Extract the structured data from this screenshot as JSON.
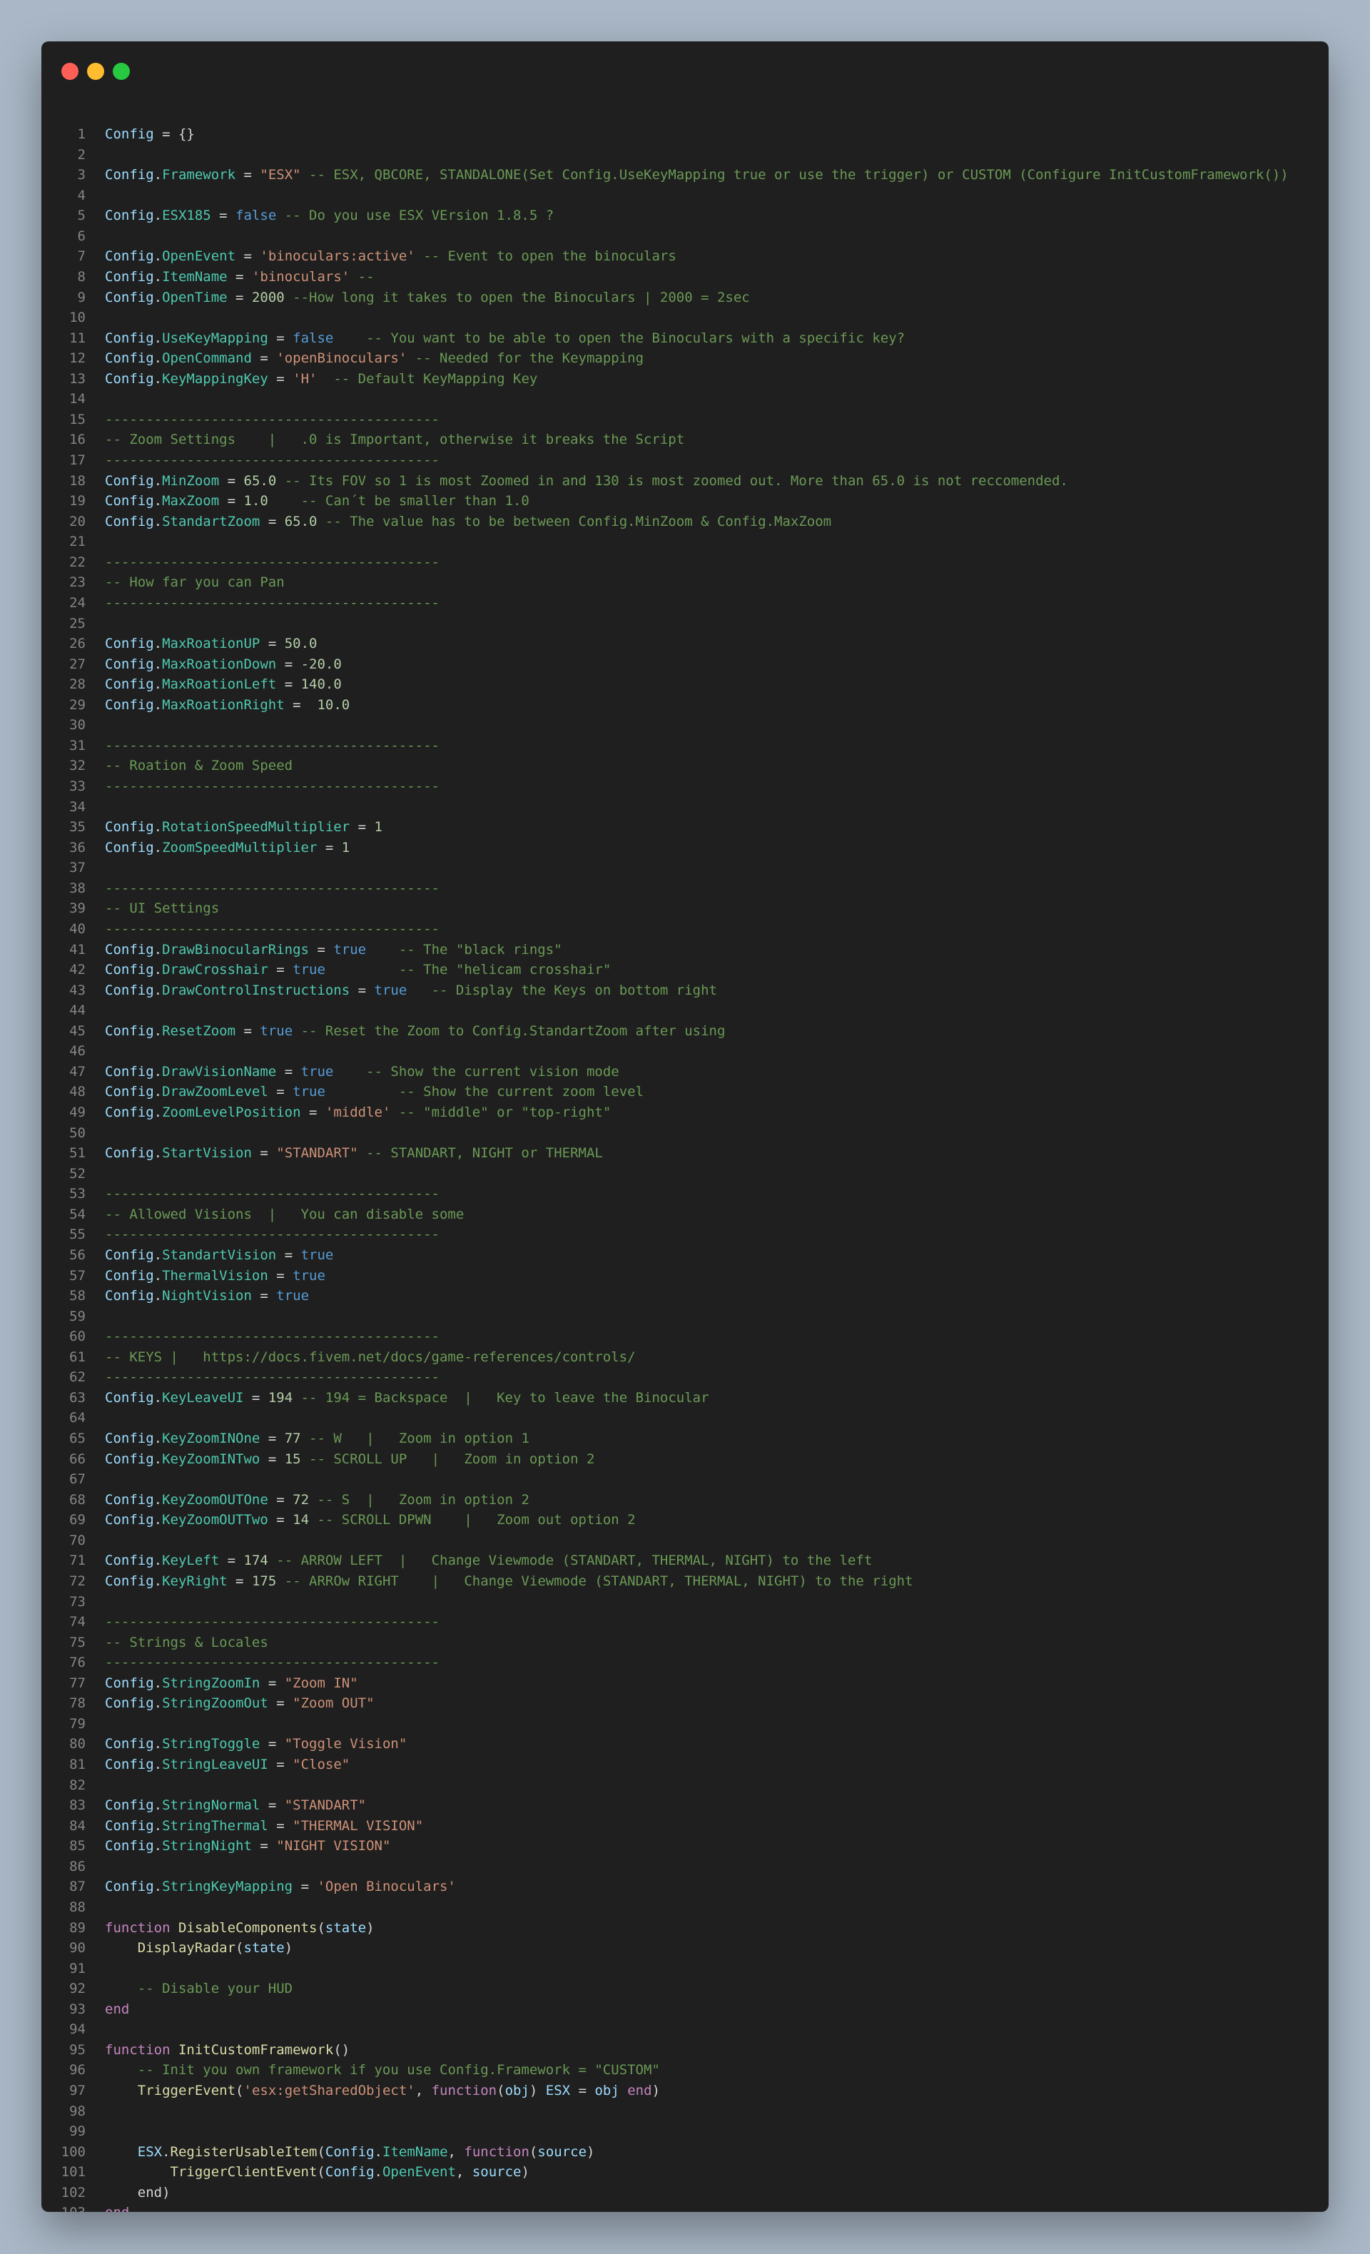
{
  "colors": {
    "background": "#a9b7c6",
    "editor": "#1f1f1f",
    "close": "#ff5f57",
    "minimize": "#febc2e",
    "zoom": "#28c840"
  },
  "lines": [
    [
      [
        "var",
        "Config"
      ],
      [
        "pl",
        " = {}"
      ]
    ],
    [],
    [
      [
        "var",
        "Config"
      ],
      [
        "pl",
        "."
      ],
      [
        "prop",
        "Framework"
      ],
      [
        "pl",
        " = "
      ],
      [
        "str",
        "\"ESX\""
      ],
      [
        "com",
        " -- ESX, QBCORE, STANDALONE(Set Config.UseKeyMapping true or use the trigger) or CUSTOM (Configure InitCustomFramework())"
      ]
    ],
    [],
    [
      [
        "var",
        "Config"
      ],
      [
        "pl",
        "."
      ],
      [
        "prop",
        "ESX185"
      ],
      [
        "pl",
        " = "
      ],
      [
        "bool",
        "false"
      ],
      [
        "com",
        " -- Do you use ESX VErsion 1.8.5 ?"
      ]
    ],
    [],
    [
      [
        "var",
        "Config"
      ],
      [
        "pl",
        "."
      ],
      [
        "prop",
        "OpenEvent"
      ],
      [
        "pl",
        " = "
      ],
      [
        "str",
        "'binoculars:active'"
      ],
      [
        "com",
        " -- Event to open the binoculars"
      ]
    ],
    [
      [
        "var",
        "Config"
      ],
      [
        "pl",
        "."
      ],
      [
        "prop",
        "ItemName"
      ],
      [
        "pl",
        " = "
      ],
      [
        "str",
        "'binoculars'"
      ],
      [
        "com",
        " --"
      ]
    ],
    [
      [
        "var",
        "Config"
      ],
      [
        "pl",
        "."
      ],
      [
        "prop",
        "OpenTime"
      ],
      [
        "pl",
        " = "
      ],
      [
        "num",
        "2000"
      ],
      [
        "com",
        " --How long it takes to open the Binoculars | 2000 = 2sec"
      ]
    ],
    [],
    [
      [
        "var",
        "Config"
      ],
      [
        "pl",
        "."
      ],
      [
        "prop",
        "UseKeyMapping"
      ],
      [
        "pl",
        " = "
      ],
      [
        "bool",
        "false"
      ],
      [
        "com",
        "    -- You want to be able to open the Binoculars with a specific key?"
      ]
    ],
    [
      [
        "var",
        "Config"
      ],
      [
        "pl",
        "."
      ],
      [
        "prop",
        "OpenCommand"
      ],
      [
        "pl",
        " = "
      ],
      [
        "str",
        "'openBinoculars'"
      ],
      [
        "com",
        " -- Needed for the Keymapping"
      ]
    ],
    [
      [
        "var",
        "Config"
      ],
      [
        "pl",
        "."
      ],
      [
        "prop",
        "KeyMappingKey"
      ],
      [
        "pl",
        " = "
      ],
      [
        "str",
        "'H'"
      ],
      [
        "com",
        "  -- Default KeyMapping Key"
      ]
    ],
    [],
    [
      [
        "com",
        "-----------------------------------------"
      ]
    ],
    [
      [
        "com",
        "-- Zoom Settings    |   .0 is Important, otherwise it breaks the Script"
      ]
    ],
    [
      [
        "com",
        "-----------------------------------------"
      ]
    ],
    [
      [
        "var",
        "Config"
      ],
      [
        "pl",
        "."
      ],
      [
        "prop",
        "MinZoom"
      ],
      [
        "pl",
        " = "
      ],
      [
        "num",
        "65.0"
      ],
      [
        "com",
        " -- Its FOV so 1 is most Zoomed in and 130 is most zoomed out. More than 65.0 is not reccomended."
      ]
    ],
    [
      [
        "var",
        "Config"
      ],
      [
        "pl",
        "."
      ],
      [
        "prop",
        "MaxZoom"
      ],
      [
        "pl",
        " = "
      ],
      [
        "num",
        "1.0"
      ],
      [
        "com",
        "    -- Can´t be smaller than 1.0"
      ]
    ],
    [
      [
        "var",
        "Config"
      ],
      [
        "pl",
        "."
      ],
      [
        "prop",
        "StandartZoom"
      ],
      [
        "pl",
        " = "
      ],
      [
        "num",
        "65.0"
      ],
      [
        "com",
        " -- The value has to be between Config.MinZoom & Config.MaxZoom"
      ]
    ],
    [],
    [
      [
        "com",
        "-----------------------------------------"
      ]
    ],
    [
      [
        "com",
        "-- How far you can Pan"
      ]
    ],
    [
      [
        "com",
        "-----------------------------------------"
      ]
    ],
    [],
    [
      [
        "var",
        "Config"
      ],
      [
        "pl",
        "."
      ],
      [
        "prop",
        "MaxRoationUP"
      ],
      [
        "pl",
        " = "
      ],
      [
        "num",
        "50.0"
      ]
    ],
    [
      [
        "var",
        "Config"
      ],
      [
        "pl",
        "."
      ],
      [
        "prop",
        "MaxRoationDown"
      ],
      [
        "pl",
        " = "
      ],
      [
        "num",
        "-20.0"
      ]
    ],
    [
      [
        "var",
        "Config"
      ],
      [
        "pl",
        "."
      ],
      [
        "prop",
        "MaxRoationLeft"
      ],
      [
        "pl",
        " = "
      ],
      [
        "num",
        "140.0"
      ]
    ],
    [
      [
        "var",
        "Config"
      ],
      [
        "pl",
        "."
      ],
      [
        "prop",
        "MaxRoationRight"
      ],
      [
        "pl",
        " =  "
      ],
      [
        "num",
        "10.0"
      ]
    ],
    [],
    [
      [
        "com",
        "-----------------------------------------"
      ]
    ],
    [
      [
        "com",
        "-- Roation & Zoom Speed"
      ]
    ],
    [
      [
        "com",
        "-----------------------------------------"
      ]
    ],
    [],
    [
      [
        "var",
        "Config"
      ],
      [
        "pl",
        "."
      ],
      [
        "prop",
        "RotationSpeedMultiplier"
      ],
      [
        "pl",
        " = "
      ],
      [
        "num",
        "1"
      ]
    ],
    [
      [
        "var",
        "Config"
      ],
      [
        "pl",
        "."
      ],
      [
        "prop",
        "ZoomSpeedMultiplier"
      ],
      [
        "pl",
        " = "
      ],
      [
        "num",
        "1"
      ]
    ],
    [],
    [
      [
        "com",
        "-----------------------------------------"
      ]
    ],
    [
      [
        "com",
        "-- UI Settings"
      ]
    ],
    [
      [
        "com",
        "-----------------------------------------"
      ]
    ],
    [
      [
        "var",
        "Config"
      ],
      [
        "pl",
        "."
      ],
      [
        "prop",
        "DrawBinocularRings"
      ],
      [
        "pl",
        " = "
      ],
      [
        "bool",
        "true"
      ],
      [
        "com",
        "    -- The \"black rings\""
      ]
    ],
    [
      [
        "var",
        "Config"
      ],
      [
        "pl",
        "."
      ],
      [
        "prop",
        "DrawCrosshair"
      ],
      [
        "pl",
        " = "
      ],
      [
        "bool",
        "true"
      ],
      [
        "com",
        "         -- The \"helicam crosshair\""
      ]
    ],
    [
      [
        "var",
        "Config"
      ],
      [
        "pl",
        "."
      ],
      [
        "prop",
        "DrawControlInstructions"
      ],
      [
        "pl",
        " = "
      ],
      [
        "bool",
        "true"
      ],
      [
        "com",
        "   -- Display the Keys on bottom right"
      ]
    ],
    [],
    [
      [
        "var",
        "Config"
      ],
      [
        "pl",
        "."
      ],
      [
        "prop",
        "ResetZoom"
      ],
      [
        "pl",
        " = "
      ],
      [
        "bool",
        "true"
      ],
      [
        "com",
        " -- Reset the Zoom to Config.StandartZoom after using"
      ]
    ],
    [],
    [
      [
        "var",
        "Config"
      ],
      [
        "pl",
        "."
      ],
      [
        "prop",
        "DrawVisionName"
      ],
      [
        "pl",
        " = "
      ],
      [
        "bool",
        "true"
      ],
      [
        "com",
        "    -- Show the current vision mode"
      ]
    ],
    [
      [
        "var",
        "Config"
      ],
      [
        "pl",
        "."
      ],
      [
        "prop",
        "DrawZoomLevel"
      ],
      [
        "pl",
        " = "
      ],
      [
        "bool",
        "true"
      ],
      [
        "com",
        "         -- Show the current zoom level"
      ]
    ],
    [
      [
        "var",
        "Config"
      ],
      [
        "pl",
        "."
      ],
      [
        "prop",
        "ZoomLevelPosition"
      ],
      [
        "pl",
        " = "
      ],
      [
        "str",
        "'middle'"
      ],
      [
        "com",
        " -- \"middle\" or \"top-right\""
      ]
    ],
    [],
    [
      [
        "var",
        "Config"
      ],
      [
        "pl",
        "."
      ],
      [
        "prop",
        "StartVision"
      ],
      [
        "pl",
        " = "
      ],
      [
        "str",
        "\"STANDART\""
      ],
      [
        "com",
        " -- STANDART, NIGHT or THERMAL"
      ]
    ],
    [],
    [
      [
        "com",
        "-----------------------------------------"
      ]
    ],
    [
      [
        "com",
        "-- Allowed Visions  |   You can disable some"
      ]
    ],
    [
      [
        "com",
        "-----------------------------------------"
      ]
    ],
    [
      [
        "var",
        "Config"
      ],
      [
        "pl",
        "."
      ],
      [
        "prop",
        "StandartVision"
      ],
      [
        "pl",
        " = "
      ],
      [
        "bool",
        "true"
      ]
    ],
    [
      [
        "var",
        "Config"
      ],
      [
        "pl",
        "."
      ],
      [
        "prop",
        "ThermalVision"
      ],
      [
        "pl",
        " = "
      ],
      [
        "bool",
        "true"
      ]
    ],
    [
      [
        "var",
        "Config"
      ],
      [
        "pl",
        "."
      ],
      [
        "prop",
        "NightVision"
      ],
      [
        "pl",
        " = "
      ],
      [
        "bool",
        "true"
      ]
    ],
    [],
    [
      [
        "com",
        "-----------------------------------------"
      ]
    ],
    [
      [
        "com",
        "-- KEYS |   https://docs.fivem.net/docs/game-references/controls/"
      ]
    ],
    [
      [
        "com",
        "-----------------------------------------"
      ]
    ],
    [
      [
        "var",
        "Config"
      ],
      [
        "pl",
        "."
      ],
      [
        "prop",
        "KeyLeaveUI"
      ],
      [
        "pl",
        " = "
      ],
      [
        "num",
        "194"
      ],
      [
        "com",
        " -- 194 = Backspace  |   Key to leave the Binocular"
      ]
    ],
    [],
    [
      [
        "var",
        "Config"
      ],
      [
        "pl",
        "."
      ],
      [
        "prop",
        "KeyZoomINOne"
      ],
      [
        "pl",
        " = "
      ],
      [
        "num",
        "77"
      ],
      [
        "com",
        " -- W   |   Zoom in option 1"
      ]
    ],
    [
      [
        "var",
        "Config"
      ],
      [
        "pl",
        "."
      ],
      [
        "prop",
        "KeyZoomINTwo"
      ],
      [
        "pl",
        " = "
      ],
      [
        "num",
        "15"
      ],
      [
        "com",
        " -- SCROLL UP   |   Zoom in option 2"
      ]
    ],
    [],
    [
      [
        "var",
        "Config"
      ],
      [
        "pl",
        "."
      ],
      [
        "prop",
        "KeyZoomOUTOne"
      ],
      [
        "pl",
        " = "
      ],
      [
        "num",
        "72"
      ],
      [
        "com",
        " -- S  |   Zoom in option 2"
      ]
    ],
    [
      [
        "var",
        "Config"
      ],
      [
        "pl",
        "."
      ],
      [
        "prop",
        "KeyZoomOUTTwo"
      ],
      [
        "pl",
        " = "
      ],
      [
        "num",
        "14"
      ],
      [
        "com",
        " -- SCROLL DPWN    |   Zoom out option 2"
      ]
    ],
    [],
    [
      [
        "var",
        "Config"
      ],
      [
        "pl",
        "."
      ],
      [
        "prop",
        "KeyLeft"
      ],
      [
        "pl",
        " = "
      ],
      [
        "num",
        "174"
      ],
      [
        "com",
        " -- ARROW LEFT  |   Change Viewmode (STANDART, THERMAL, NIGHT) to the left"
      ]
    ],
    [
      [
        "var",
        "Config"
      ],
      [
        "pl",
        "."
      ],
      [
        "prop",
        "KeyRight"
      ],
      [
        "pl",
        " = "
      ],
      [
        "num",
        "175"
      ],
      [
        "com",
        " -- ARROw RIGHT    |   Change Viewmode (STANDART, THERMAL, NIGHT) to the right"
      ]
    ],
    [],
    [
      [
        "com",
        "-----------------------------------------"
      ]
    ],
    [
      [
        "com",
        "-- Strings & Locales"
      ]
    ],
    [
      [
        "com",
        "-----------------------------------------"
      ]
    ],
    [
      [
        "var",
        "Config"
      ],
      [
        "pl",
        "."
      ],
      [
        "prop",
        "StringZoomIn"
      ],
      [
        "pl",
        " = "
      ],
      [
        "str",
        "\"Zoom IN\""
      ]
    ],
    [
      [
        "var",
        "Config"
      ],
      [
        "pl",
        "."
      ],
      [
        "prop",
        "StringZoomOut"
      ],
      [
        "pl",
        " = "
      ],
      [
        "str",
        "\"Zoom OUT\""
      ]
    ],
    [],
    [
      [
        "var",
        "Config"
      ],
      [
        "pl",
        "."
      ],
      [
        "prop",
        "StringToggle"
      ],
      [
        "pl",
        " = "
      ],
      [
        "str",
        "\"Toggle Vision\""
      ]
    ],
    [
      [
        "var",
        "Config"
      ],
      [
        "pl",
        "."
      ],
      [
        "prop",
        "StringLeaveUI"
      ],
      [
        "pl",
        " = "
      ],
      [
        "str",
        "\"Close\""
      ]
    ],
    [],
    [
      [
        "var",
        "Config"
      ],
      [
        "pl",
        "."
      ],
      [
        "prop",
        "StringNormal"
      ],
      [
        "pl",
        " = "
      ],
      [
        "str",
        "\"STANDART\""
      ]
    ],
    [
      [
        "var",
        "Config"
      ],
      [
        "pl",
        "."
      ],
      [
        "prop",
        "StringThermal"
      ],
      [
        "pl",
        " = "
      ],
      [
        "str",
        "\"THERMAL VISION\""
      ]
    ],
    [
      [
        "var",
        "Config"
      ],
      [
        "pl",
        "."
      ],
      [
        "prop",
        "StringNight"
      ],
      [
        "pl",
        " = "
      ],
      [
        "str",
        "\"NIGHT VISION\""
      ]
    ],
    [],
    [
      [
        "var",
        "Config"
      ],
      [
        "pl",
        "."
      ],
      [
        "prop",
        "StringKeyMapping"
      ],
      [
        "pl",
        " = "
      ],
      [
        "str",
        "'Open Binoculars'"
      ]
    ],
    [],
    [
      [
        "kw",
        "function"
      ],
      [
        "pl",
        " "
      ],
      [
        "fn",
        "DisableComponents"
      ],
      [
        "pl",
        "("
      ],
      [
        "var",
        "state"
      ],
      [
        "pl",
        ")"
      ]
    ],
    [
      [
        "pl",
        "    "
      ],
      [
        "fn",
        "DisplayRadar"
      ],
      [
        "pl",
        "("
      ],
      [
        "var",
        "state"
      ],
      [
        "pl",
        ")"
      ]
    ],
    [],
    [
      [
        "pl",
        "    "
      ],
      [
        "com",
        "-- Disable your HUD"
      ]
    ],
    [
      [
        "kw",
        "end"
      ]
    ],
    [],
    [
      [
        "kw",
        "function"
      ],
      [
        "pl",
        " "
      ],
      [
        "fn",
        "InitCustomFramework"
      ],
      [
        "pl",
        "()"
      ]
    ],
    [
      [
        "pl",
        "    "
      ],
      [
        "com",
        "-- Init you own framework if you use Config.Framework = \"CUSTOM\""
      ]
    ],
    [
      [
        "pl",
        "    "
      ],
      [
        "fn",
        "TriggerEvent"
      ],
      [
        "pl",
        "("
      ],
      [
        "str",
        "'esx:getSharedObject'"
      ],
      [
        "pl",
        ", "
      ],
      [
        "kw",
        "function"
      ],
      [
        "pl",
        "("
      ],
      [
        "var",
        "obj"
      ],
      [
        "pl",
        ") "
      ],
      [
        "var",
        "ESX"
      ],
      [
        "pl",
        " = "
      ],
      [
        "var",
        "obj"
      ],
      [
        "pl",
        " "
      ],
      [
        "kw",
        "end"
      ],
      [
        "pl",
        ")"
      ]
    ],
    [],
    [],
    [
      [
        "pl",
        "    "
      ],
      [
        "var",
        "ESX"
      ],
      [
        "pl",
        "."
      ],
      [
        "fn",
        "RegisterUsableItem"
      ],
      [
        "pl",
        "("
      ],
      [
        "var",
        "Config"
      ],
      [
        "pl",
        "."
      ],
      [
        "prop",
        "ItemName"
      ],
      [
        "pl",
        ", "
      ],
      [
        "kw",
        "function"
      ],
      [
        "pl",
        "("
      ],
      [
        "var",
        "source"
      ],
      [
        "pl",
        ")"
      ]
    ],
    [
      [
        "pl",
        "        "
      ],
      [
        "fn",
        "TriggerClientEvent"
      ],
      [
        "pl",
        "("
      ],
      [
        "var",
        "Config"
      ],
      [
        "pl",
        "."
      ],
      [
        "prop",
        "OpenEvent"
      ],
      [
        "pl",
        ", "
      ],
      [
        "var",
        "source"
      ],
      [
        "pl",
        ")"
      ]
    ],
    [
      [
        "pl",
        "    "
      ],
      [
        "pl",
        "end)"
      ]
    ],
    [
      [
        "kw",
        "end"
      ]
    ]
  ]
}
